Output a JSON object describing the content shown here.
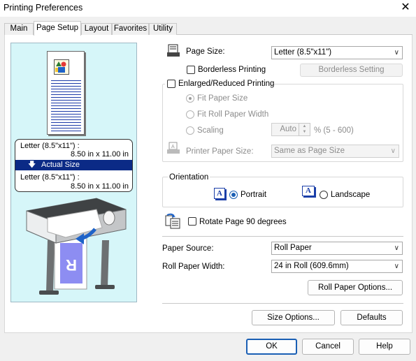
{
  "window": {
    "title": "Printing Preferences",
    "close_glyph": "✕"
  },
  "tabs": [
    {
      "label": "Main"
    },
    {
      "label": "Page Setup"
    },
    {
      "label": "Layout"
    },
    {
      "label": "Favorites"
    },
    {
      "label": "Utility"
    }
  ],
  "preview": {
    "source_size": "Letter (8.5\"x11\") :",
    "source_dims": "8.50 in x 11.00 in",
    "actual_size_label": "Actual Size",
    "actual_arrow": "🡇",
    "target_size": "Letter (8.5\"x11\") :",
    "target_dims": "8.50 in x 11.00 in",
    "printer_letter": "R"
  },
  "page_size": {
    "label": "Page Size:",
    "value": "Letter (8.5\"x11\")"
  },
  "borderless": {
    "label": "Borderless Printing",
    "checked": false,
    "setting_button": "Borderless Setting"
  },
  "enlarged": {
    "label": "Enlarged/Reduced Printing",
    "checked": false,
    "fit_paper": "Fit Paper Size",
    "fit_roll": "Fit Roll Paper Width",
    "scaling": "Scaling",
    "scaling_value": "Auto",
    "scaling_range": "% (5 - 600)",
    "printer_paper_label": "Printer Paper Size:",
    "printer_paper_value": "Same as Page Size"
  },
  "orientation": {
    "group_label": "Orientation",
    "portrait": "Portrait",
    "landscape": "Landscape",
    "selected": "Portrait",
    "icon_letter": "A"
  },
  "rotate": {
    "label": "Rotate Page 90 degrees",
    "checked": false
  },
  "paper_source": {
    "label": "Paper Source:",
    "value": "Roll Paper"
  },
  "roll_width": {
    "label": "Roll Paper Width:",
    "value": "24 in Roll (609.6mm)"
  },
  "buttons": {
    "roll_options": "Roll Paper Options...",
    "size_options": "Size Options...",
    "defaults": "Defaults",
    "ok": "OK",
    "cancel": "Cancel",
    "help": "Help"
  },
  "colors": {
    "accent": "#1a5fb4",
    "actual_bar": "#0b2a86",
    "preview_bg": "#d6f6f9"
  }
}
